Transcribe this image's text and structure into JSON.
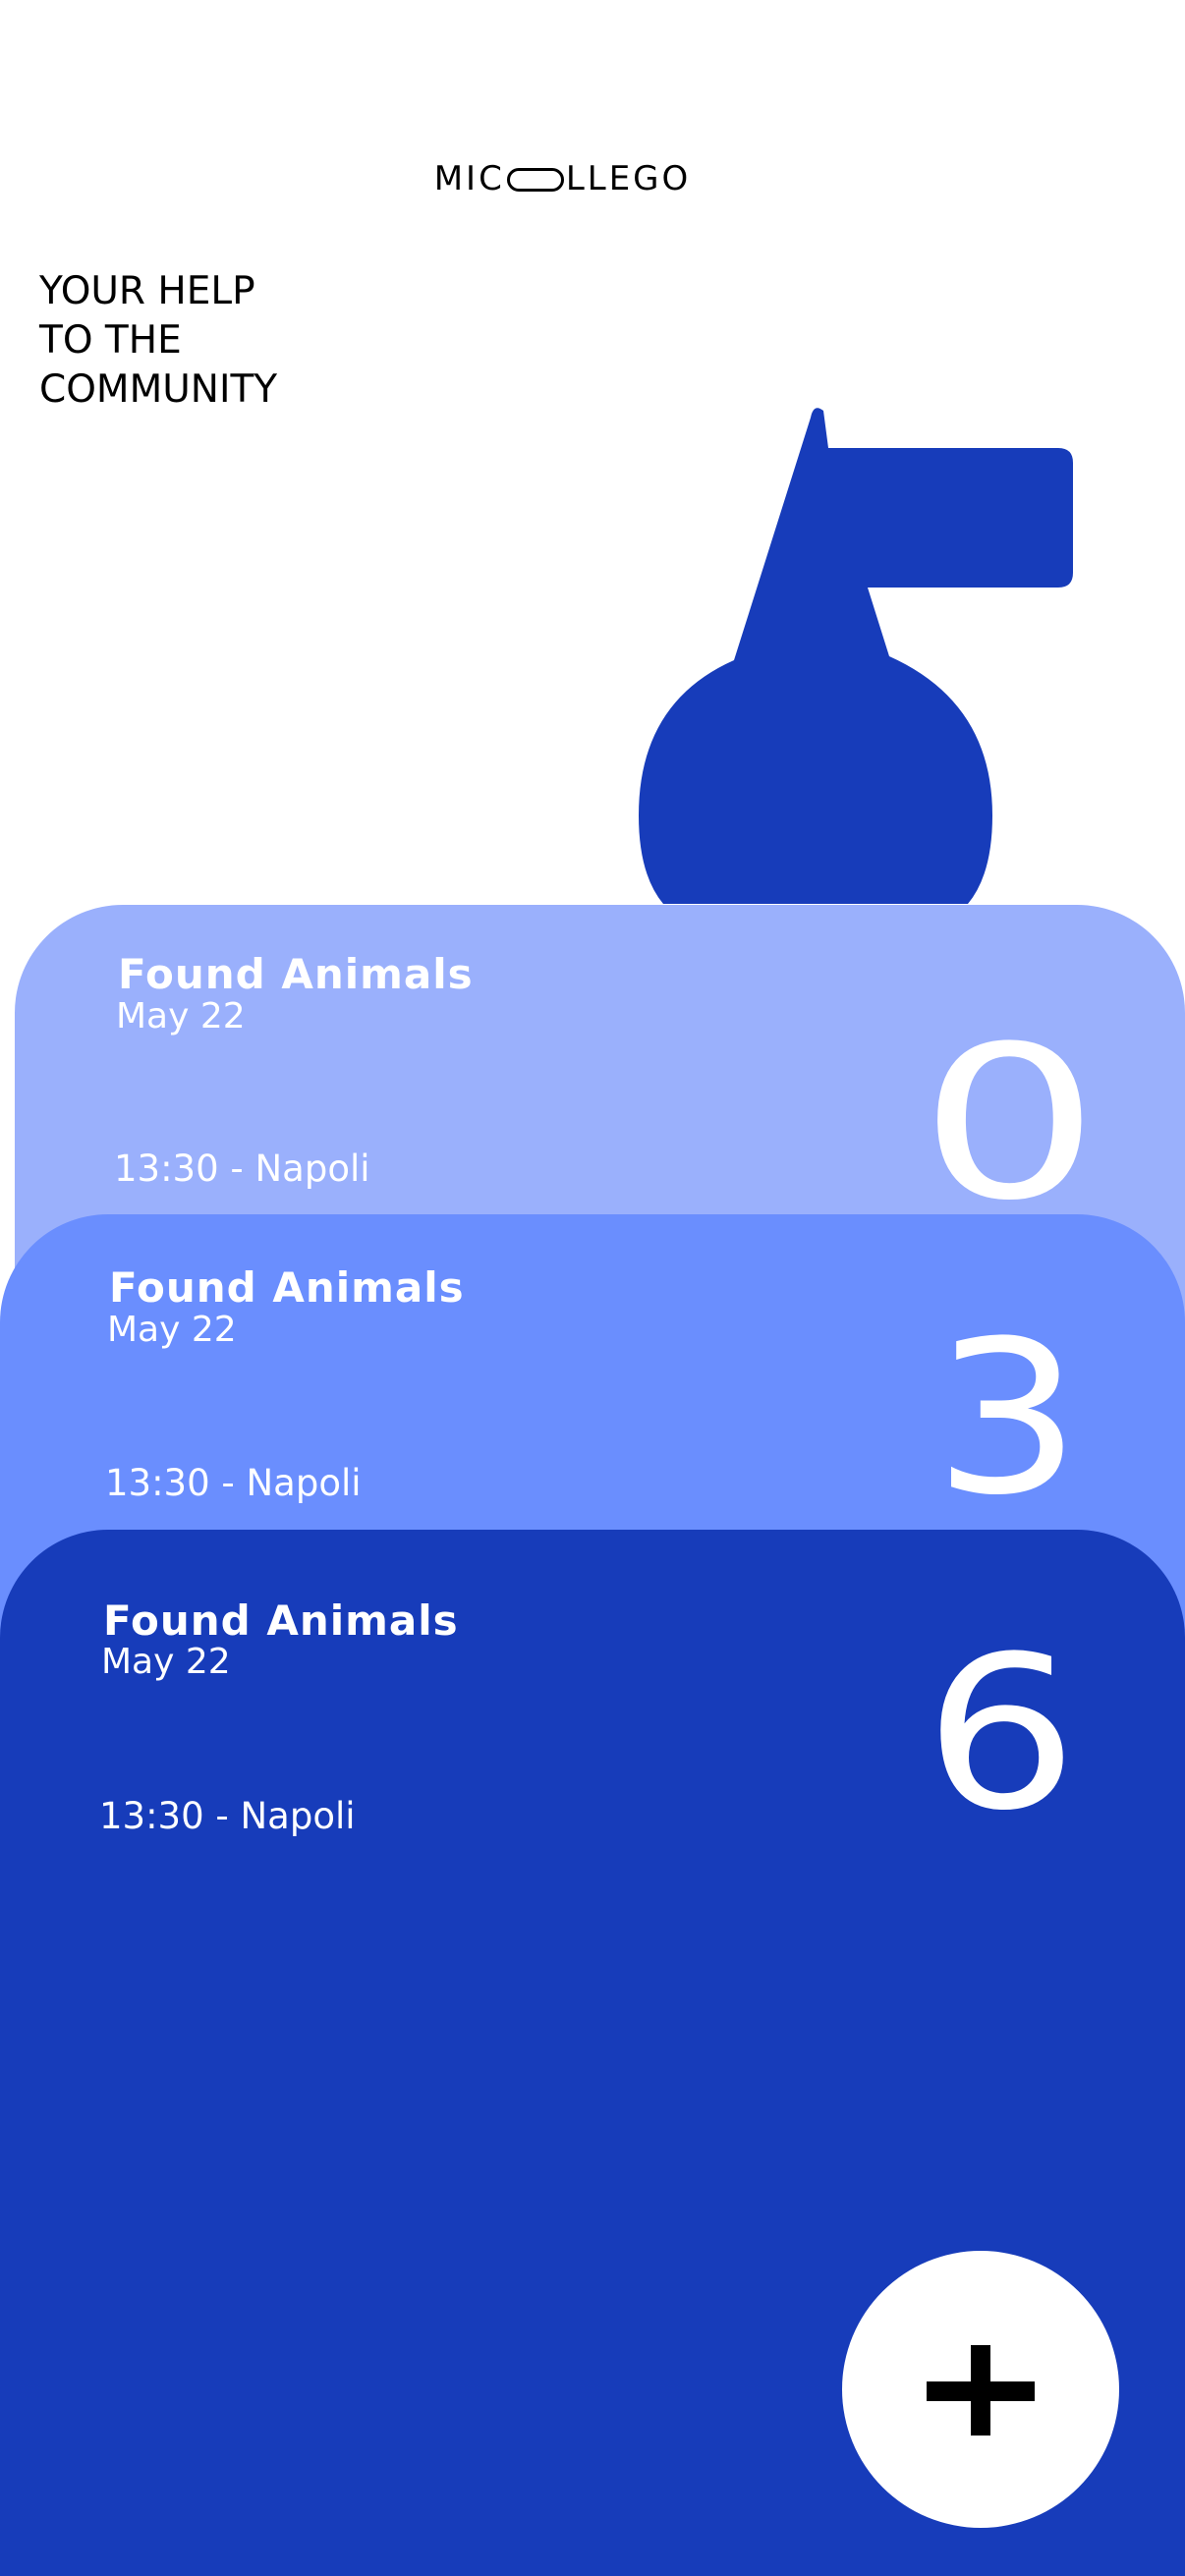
{
  "brand": {
    "logo_start": "MIC",
    "logo_end": "LLEGO"
  },
  "header": {
    "line1": "YOUR HELP",
    "line2": "TO THE",
    "line3": "COMMUNITY"
  },
  "colors": {
    "brand_blue": "#173cba",
    "card_light": "#9ab0fc",
    "card_medium": "#6a8efe",
    "card_dark": "#173cba",
    "background": "#ffffff",
    "text_on_card": "#ffffff",
    "text_primary": "#000000"
  },
  "hero": {
    "icon": "dog-silhouette-icon"
  },
  "cards": [
    {
      "title": "Found Animals",
      "date": "May 22",
      "time_location": "13:30 - Napoli",
      "number": "0"
    },
    {
      "title": "Found Animals",
      "date": "May 22",
      "time_location": "13:30 - Napoli",
      "number": "3"
    },
    {
      "title": "Found Animals",
      "date": "May 22",
      "time_location": "13:30 - Napoli",
      "number": "6"
    }
  ],
  "fab": {
    "icon": "plus-icon"
  }
}
